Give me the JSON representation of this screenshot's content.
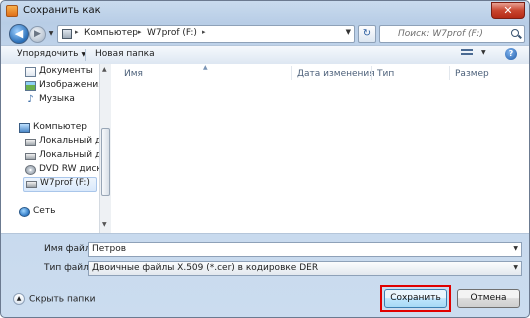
{
  "window": {
    "title": "Сохранить как",
    "close_glyph": "✕"
  },
  "address": {
    "crumbs": [
      "Компьютер",
      "W7prof (F:)"
    ],
    "separator": "▸",
    "refresh_glyph": "↻",
    "search_placeholder": "Поиск: W7prof (F:)"
  },
  "toolbar": {
    "organize_label": "Упорядочить",
    "new_folder_label": "Новая папка",
    "help_glyph": "?"
  },
  "nav": {
    "items": [
      {
        "label": "Документы",
        "icon": "documents-icon"
      },
      {
        "label": "Изображения",
        "icon": "pictures-icon"
      },
      {
        "label": "Музыка",
        "icon": "music-icon"
      },
      {
        "label": "Компьютер",
        "icon": "computer-icon"
      },
      {
        "label": "Локальный диск",
        "icon": "local-disk-icon"
      },
      {
        "label": "Локальный диск",
        "icon": "local-disk-icon"
      },
      {
        "label": "DVD RW дисков",
        "icon": "dvd-drive-icon"
      },
      {
        "label": "W7prof (F:)",
        "icon": "usb-drive-icon",
        "selected": true
      },
      {
        "label": "Сеть",
        "icon": "network-icon"
      }
    ]
  },
  "list": {
    "columns": [
      "Имя",
      "Дата изменения",
      "Тип",
      "Размер"
    ]
  },
  "form": {
    "filename_label": "Имя файла:",
    "filename_value": "Петров",
    "filetype_label": "Тип файла:",
    "filetype_value": "Двоичные файлы X.509 (*.cer) в кодировке DER"
  },
  "footer": {
    "hide_folders_label": "Скрыть папки",
    "save_label": "Сохранить",
    "cancel_label": "Отмена"
  },
  "colors": {
    "accent_highlight": "#e00000",
    "window_frame": "#b8cde6",
    "close_button": "#c9462f"
  }
}
